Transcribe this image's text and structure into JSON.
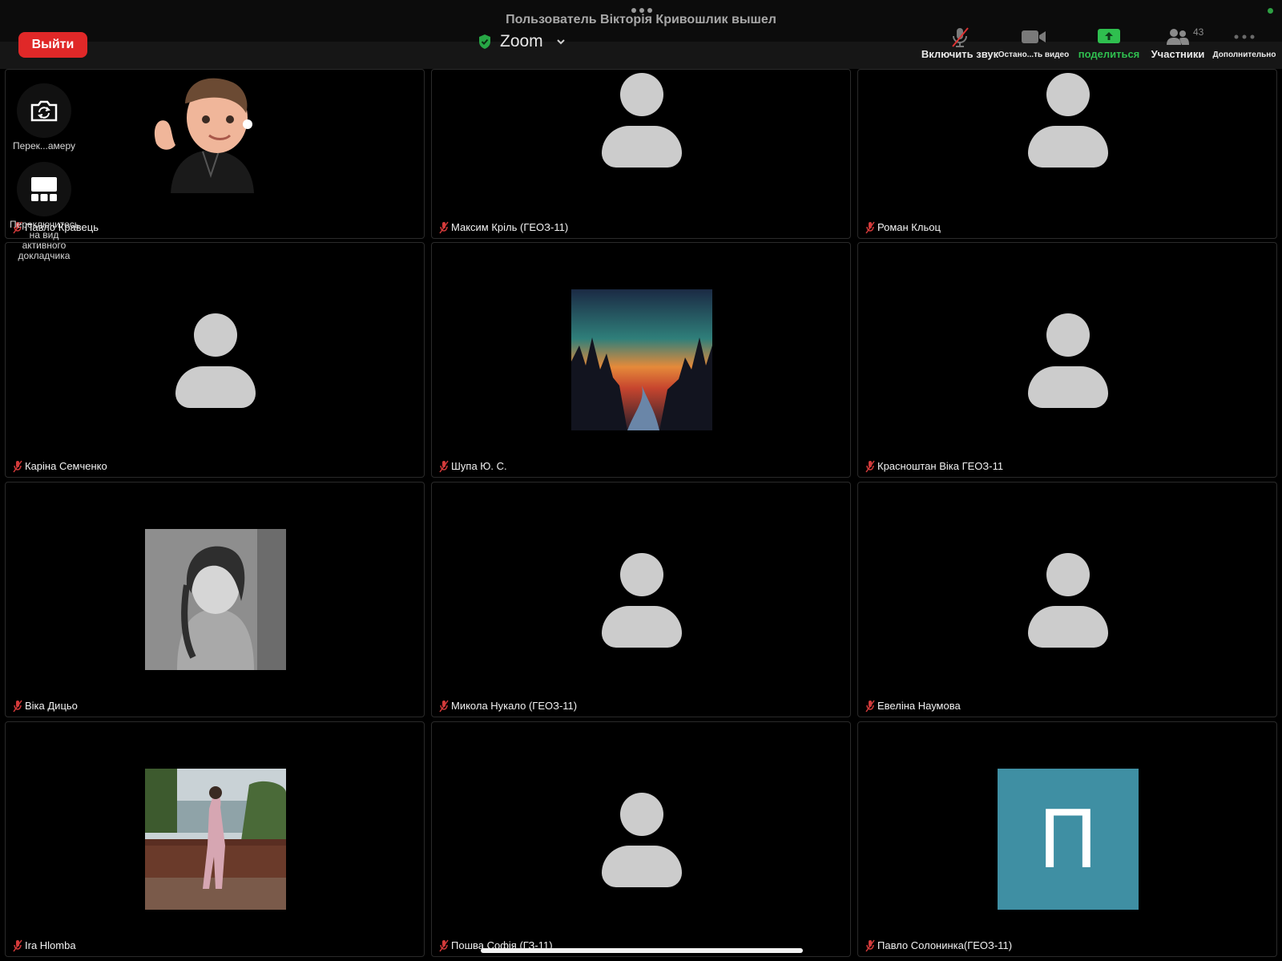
{
  "topbar": {
    "notice": "Пользователь Вікторія Кривошлик вышел",
    "leave_label": "Выйти",
    "app_name": "Zoom",
    "tools": {
      "audio": "Включить звук",
      "video": "Остано...ть видео",
      "share": "поделиться",
      "participants": "Участники",
      "participants_count": "43",
      "more": "Дополнительно"
    }
  },
  "side_controls": {
    "switch_camera": "Перек...амеру",
    "switch_speaker": "Переключитесь на вид активного докладчика"
  },
  "tiles": [
    {
      "name": "Павло Кравець"
    },
    {
      "name": "Максим Кріль (ГЕОЗ-11)"
    },
    {
      "name": "Роман Кльоц"
    },
    {
      "name": "Каріна Семченко"
    },
    {
      "name": "Шупа Ю. С."
    },
    {
      "name": "Красноштан Віка ГЕОЗ-11"
    },
    {
      "name": "Віка Дицьо"
    },
    {
      "name": "Микола Нукало (ГЕОЗ-11)"
    },
    {
      "name": "Евеліна Наумова"
    },
    {
      "name": "Ira Hlomba"
    },
    {
      "name": "Пошва Софія (ГЗ-11)"
    },
    {
      "name": "Павло Солонинка(ГЕОЗ-11)",
      "initial": "П"
    }
  ],
  "colors": {
    "leave": "#e02828",
    "share_green": "#2fbf4f",
    "initial_tile": "#3f8fa3",
    "avatar_gray": "#cccccc"
  }
}
